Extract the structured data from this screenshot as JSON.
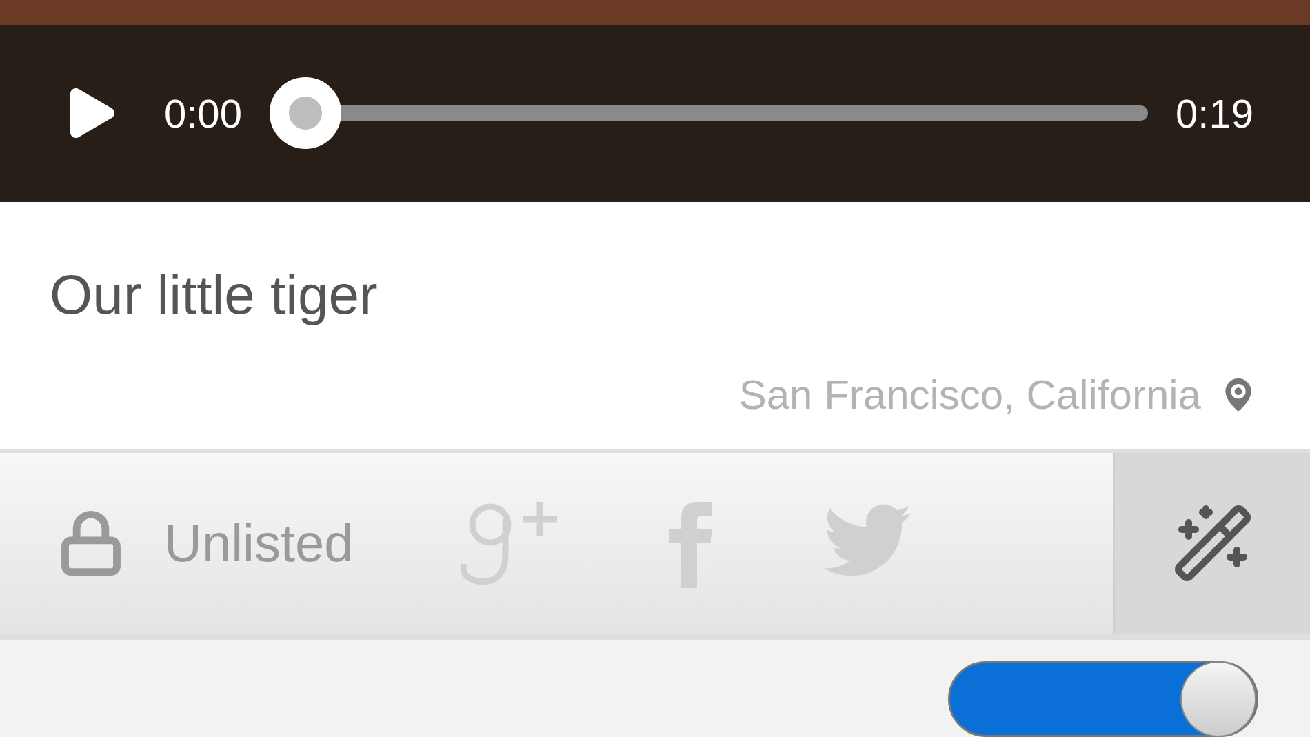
{
  "player": {
    "playing": false,
    "elapsed": "0:00",
    "duration": "0:19",
    "level": 0
  },
  "video": {
    "title": "Our little tiger",
    "location": "San Francisco, California"
  },
  "share_bar": {
    "privacy": "Unlisted",
    "services": [
      {
        "kind": "google-plus"
      },
      {
        "kind": "facebook"
      },
      {
        "kind": "twitter"
      }
    ]
  },
  "settings": [
    {
      "kind": "toggle",
      "on": true
    }
  ]
}
